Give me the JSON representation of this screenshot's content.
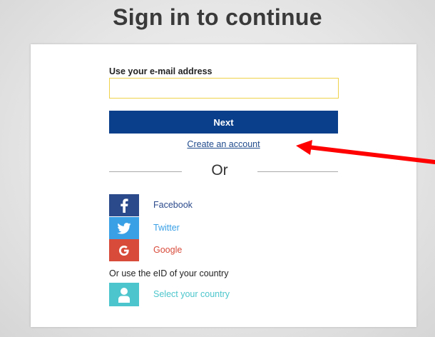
{
  "title": "Sign in to continue",
  "email": {
    "label": "Use your e-mail address",
    "value": "",
    "placeholder": ""
  },
  "next_button": "Next",
  "create_account_link": "Create an account",
  "divider_text": "Or",
  "providers": [
    {
      "name": "Facebook",
      "icon": "facebook-icon",
      "color": "#2b4a8c"
    },
    {
      "name": "Twitter",
      "icon": "twitter-icon",
      "color": "#3aa0e6"
    },
    {
      "name": "Google",
      "icon": "google-icon",
      "color": "#d84a3a"
    }
  ],
  "eid": {
    "label": "Or use the eID of your country",
    "button_label": "Select your country",
    "icon": "person-icon",
    "color": "#4cc6cc"
  },
  "colors": {
    "primary": "#0a3f8c",
    "input_border": "#f0d24a",
    "annotation_arrow": "#ff0000"
  }
}
